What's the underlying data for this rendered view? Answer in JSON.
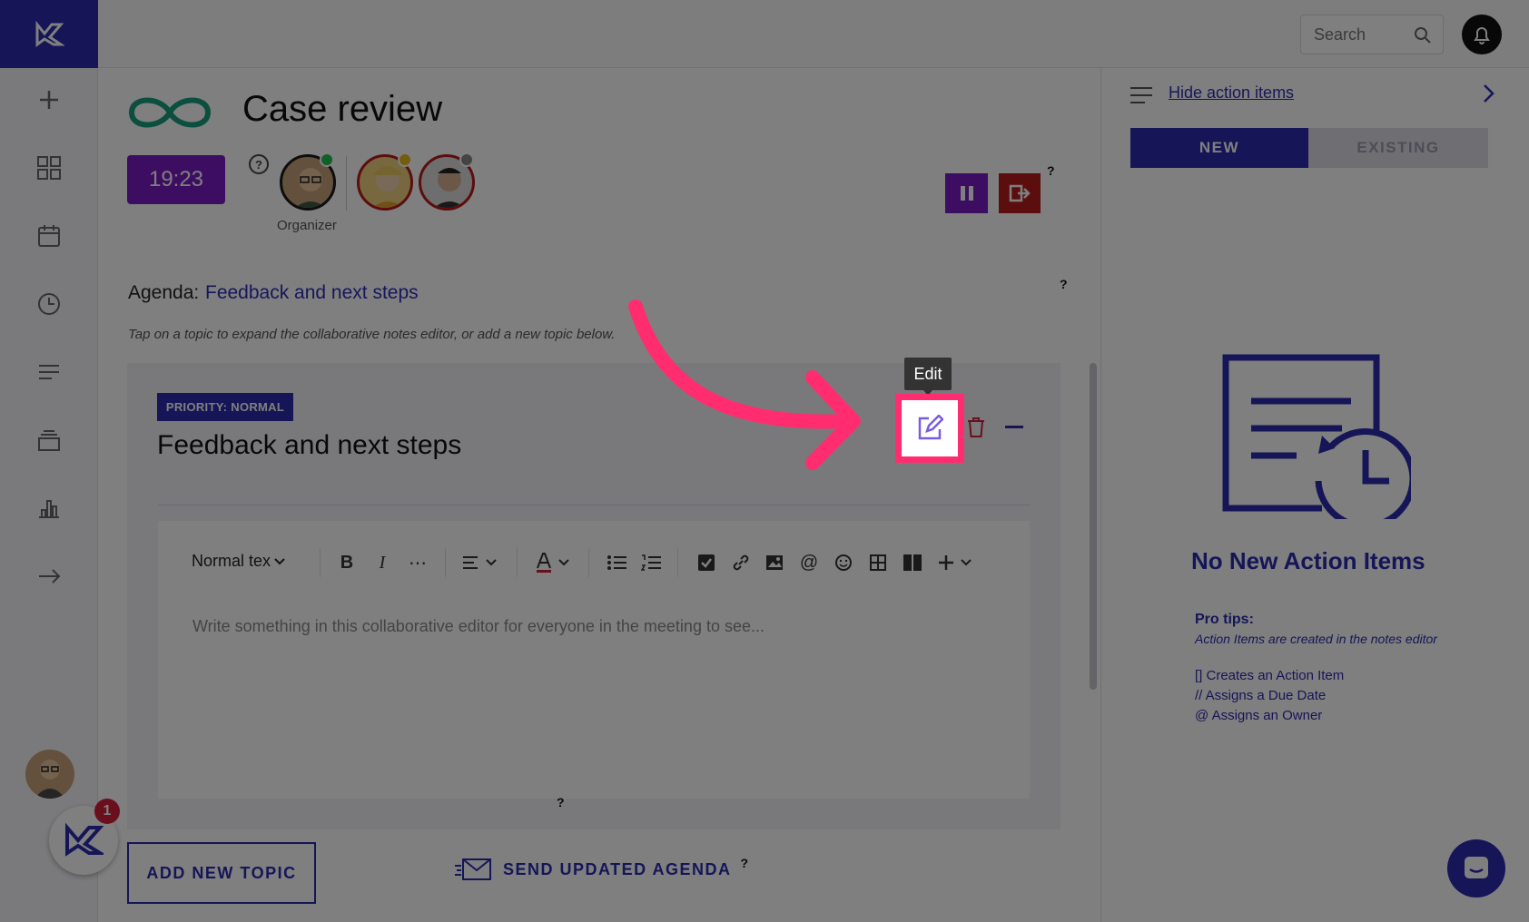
{
  "nav": {
    "items": [
      "add-icon",
      "dashboard-icon",
      "calendar-icon",
      "clock-icon",
      "list-icon",
      "archive-icon",
      "chart-icon",
      "arrow-right-icon"
    ],
    "badge_count": "1"
  },
  "header": {
    "search_placeholder": "Search"
  },
  "meeting": {
    "title": "Case review",
    "timer": "19:23",
    "organizer_label": "Organizer",
    "help_mark": "?",
    "agenda_label": "Agenda:",
    "agenda_link": "Feedback and next steps",
    "hint": "Tap on a topic to expand the collaborative notes editor, or add a new topic below."
  },
  "topic": {
    "priority": "PRIORITY: NORMAL",
    "title": "Feedback and next steps",
    "edit_tooltip": "Edit"
  },
  "editor": {
    "format_select": "Normal tex",
    "placeholder": "Write something in this collaborative editor for everyone in the meeting to see..."
  },
  "footer": {
    "add_topic": "ADD NEW TOPIC",
    "send_agenda": "SEND UPDATED AGENDA"
  },
  "action_panel": {
    "hide_link": "Hide action items",
    "tab_new": "NEW",
    "tab_existing": "EXISTING",
    "empty_title": "No New Action Items",
    "pro_tips": "Pro tips:",
    "pro_sub": "Action Items are created in the notes editor",
    "tips": [
      "[] Creates an Action Item",
      "// Assigns a Due Date",
      "@ Assigns an Owner"
    ]
  },
  "colors": {
    "brand": "#2b2bb0",
    "timer": "#7a1bc4",
    "leave": "#b81a1a",
    "highlight": "#ff2d6f"
  }
}
